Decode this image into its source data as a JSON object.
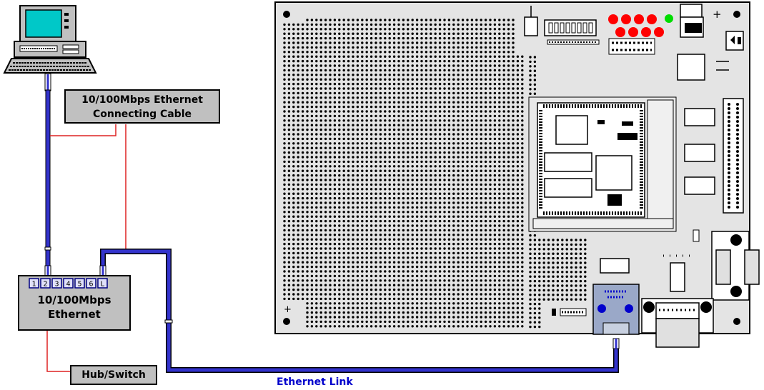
{
  "labels": {
    "cable_line1": "10/100Mbps Ethernet",
    "cable_line2": "Connecting Cable",
    "hub_line1": "10/100Mbps",
    "hub_line2": "Ethernet",
    "hub_switch": "Hub/Switch",
    "ethernet_link": "Ethernet Link"
  },
  "hub_ports": [
    "1",
    "2",
    "3",
    "4",
    "5",
    "6",
    "L"
  ],
  "board_marks": {
    "plus": "+"
  },
  "colors": {
    "cable_blue": "#3333cc",
    "connector_red": "#dd2222",
    "led_red": "#ff0000",
    "led_green": "#00dd00",
    "board_gray": "#e4e4e4"
  },
  "icons": [
    "computer-icon",
    "hub-icon",
    "rj45-jack-icon",
    "db9-connector-icon"
  ]
}
